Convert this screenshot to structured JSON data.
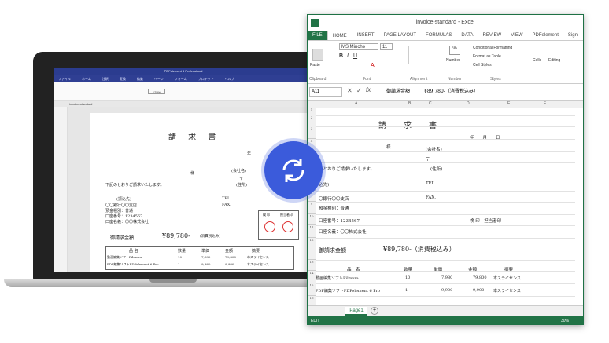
{
  "pdf": {
    "title": "PDFelement 6 Professional",
    "menu": [
      "ファイル",
      "編集",
      "ホーム",
      "注釈",
      "変換",
      "編集",
      "ページ",
      "フォーム",
      "プロテクト",
      "ヘルプ"
    ],
    "tab": "invoice-standard",
    "zoom": "125%",
    "doc": {
      "title": "請 求 書",
      "company": "(会社名)",
      "mark": "〒",
      "address": "(住所)",
      "sama": "様",
      "line1": "下記のとおりご請求いたします。",
      "furikomi": "(振込先)",
      "bank": "〇〇銀行〇〇支店",
      "type": "預金種別：普通",
      "acct": "口座番号：1234567",
      "name": "口座名義：〇〇株式会社",
      "tel": "TEL.",
      "fax": "FAX.",
      "year": "年",
      "amount_label": "御請求金額",
      "amount": "¥89,780-",
      "tax": "(消費税込み)",
      "stamp1": "検 印",
      "stamp2": "担当者印",
      "cols": [
        "品 名",
        "数量",
        "単価",
        "金額",
        "摘要"
      ],
      "rows": [
        [
          "動画編集ソフトFilmora",
          "10",
          "7,980",
          "79,800",
          "本スライセンス"
        ],
        [
          "PDF編集ソフトPDFelement 6 Pro",
          "1",
          "9,980",
          "9,980",
          "本スライセンス"
        ]
      ]
    }
  },
  "excel": {
    "title": "invoice-standard - Excel",
    "tabs": [
      "FILE",
      "HOME",
      "INSERT",
      "PAGE LAYOUT",
      "FORMULAS",
      "DATA",
      "REVIEW",
      "VIEW",
      "PDFelement"
    ],
    "signin": "Sign",
    "font": "MS Mincho",
    "size": "11",
    "paste": "Paste",
    "groups": [
      "Clipboard",
      "Font",
      "Alignment",
      "Number",
      "Styles"
    ],
    "styles": [
      "Conditional Formatting",
      "Format as Table",
      "Cell Styles"
    ],
    "cells": "Cells",
    "editing": "Editing",
    "number": "Number",
    "namebox": "A11",
    "formula": "御請求金額　　　¥89,780-（消費税込み）",
    "cols": [
      "A",
      "B",
      "C",
      "D",
      "E",
      "F"
    ],
    "sheet": "Page1",
    "status": "EDIT",
    "zoomv": "30%",
    "grid": {
      "title": "請　求　書",
      "yearmonth": "年　　月　　日",
      "sama": "様",
      "company": "(会社名)",
      "mark": "〒",
      "line1": "のとおりご請求いたします。",
      "address": "(住所)",
      "furikomi": "込先)",
      "tel": "TEL.",
      "bank": "〇銀行〇〇支店",
      "fax": "FAX.",
      "type": "預金種別：普通",
      "acct": "口座番号：1234567",
      "stamps": "検 印　担当者印",
      "name": "口座名義：〇〇株式会社",
      "amount_label": "御請求金額",
      "amount": "¥89,780-（消費税込み）",
      "cols": [
        "品　名",
        "数量",
        "単価",
        "金額",
        "摘要"
      ],
      "rows": [
        [
          "動画編集ソフトFilmora",
          "10",
          "7,980",
          "79,800",
          "本スライセンス"
        ],
        [
          "PDF編集ソフトPDFelement 6 Pro",
          "1",
          "9,900",
          "9,900",
          "本スライセンス"
        ]
      ]
    }
  },
  "colors": {
    "sync": "#3b5bdb",
    "excel": "#217346",
    "pdf": "#2b3c8f"
  }
}
